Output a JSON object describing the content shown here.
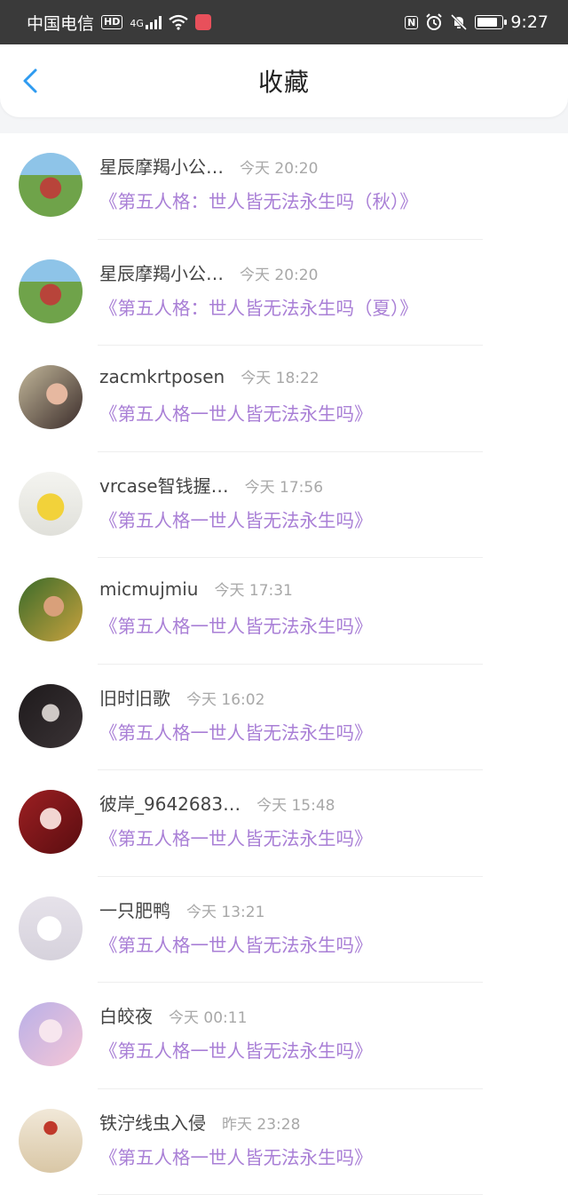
{
  "status_bar": {
    "carrier": "中国电信",
    "hd": "HD",
    "network": "4G",
    "nfc": "N",
    "time": "9:27",
    "battery_level": 0.92
  },
  "header": {
    "title": "收藏"
  },
  "colors": {
    "accent": "#2f9bf0",
    "title_purple": "#a97fd6"
  },
  "favorites": [
    {
      "user": "星辰摩羯小公…",
      "time": "今天 20:20",
      "title": "《第五人格：世人皆无法永生吗（秋）》",
      "avatar": "avatar-icon"
    },
    {
      "user": "星辰摩羯小公…",
      "time": "今天 20:20",
      "title": "《第五人格：世人皆无法永生吗（夏）》",
      "avatar": "avatar-icon"
    },
    {
      "user": "zacmkrtposen",
      "time": "今天 18:22",
      "title": "《第五人格一世人皆无法永生吗》",
      "avatar": "avatar-icon"
    },
    {
      "user": "vrcase智钱握…",
      "time": "今天 17:56",
      "title": "《第五人格一世人皆无法永生吗》",
      "avatar": "avatar-icon"
    },
    {
      "user": "micmujmiu",
      "time": "今天 17:31",
      "title": "《第五人格一世人皆无法永生吗》",
      "avatar": "avatar-icon"
    },
    {
      "user": "旧时旧歌",
      "time": "今天 16:02",
      "title": "《第五人格一世人皆无法永生吗》",
      "avatar": "avatar-icon"
    },
    {
      "user": "彼岸_9642683…",
      "time": "今天 15:48",
      "title": "《第五人格一世人皆无法永生吗》",
      "avatar": "avatar-icon"
    },
    {
      "user": "一只肥鸭",
      "time": "今天 13:21",
      "title": "《第五人格一世人皆无法永生吗》",
      "avatar": "avatar-icon"
    },
    {
      "user": "白皎夜",
      "time": "今天 00:11",
      "title": "《第五人格一世人皆无法永生吗》",
      "avatar": "avatar-icon"
    },
    {
      "user": "铁泞线虫入侵",
      "time": "昨天 23:28",
      "title": "《第五人格一世人皆无法永生吗》",
      "avatar": "avatar-icon"
    }
  ]
}
